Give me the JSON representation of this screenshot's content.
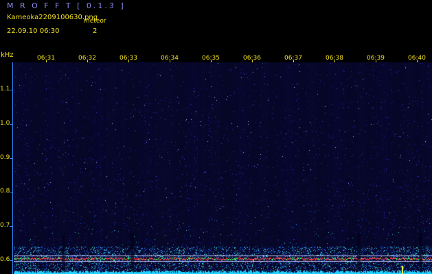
{
  "header": {
    "app_title": "M R O F F T  [ 0.1.3 ]",
    "filename": "Kameoka2209100630.png",
    "meteor_label": "meteor",
    "datetime": "22.09.10 06:30",
    "meteor_count": "2"
  },
  "axes": {
    "y_unit": "kHz",
    "y_ticks": [
      "1.1",
      "1.0",
      "0.9",
      "0.8",
      "0.7",
      "0.6"
    ],
    "x_ticks": [
      "06:31",
      "06:32",
      "06:33",
      "06:34",
      "06:35",
      "06:36",
      "06:37",
      "06:38",
      "06:39",
      "06:40"
    ]
  },
  "colors": {
    "background": "#000000",
    "text": "#f0e020",
    "title": "#8c8cf0",
    "axis": "#2a8cff",
    "carrier_line": "#c8c8ff",
    "echo": "#ff3030"
  },
  "chart_data": {
    "type": "heatmap",
    "ylabel": "kHz",
    "ylim": [
      0.56,
      1.18
    ],
    "yticks": [
      1.1,
      1.0,
      0.9,
      0.8,
      0.7,
      0.6
    ],
    "xticks": [
      "06:31",
      "06:32",
      "06:33",
      "06:34",
      "06:35",
      "06:36",
      "06:37",
      "06:38",
      "06:39",
      "06:40"
    ],
    "xlim": [
      "06:30",
      "06:40"
    ],
    "grid": false
  }
}
